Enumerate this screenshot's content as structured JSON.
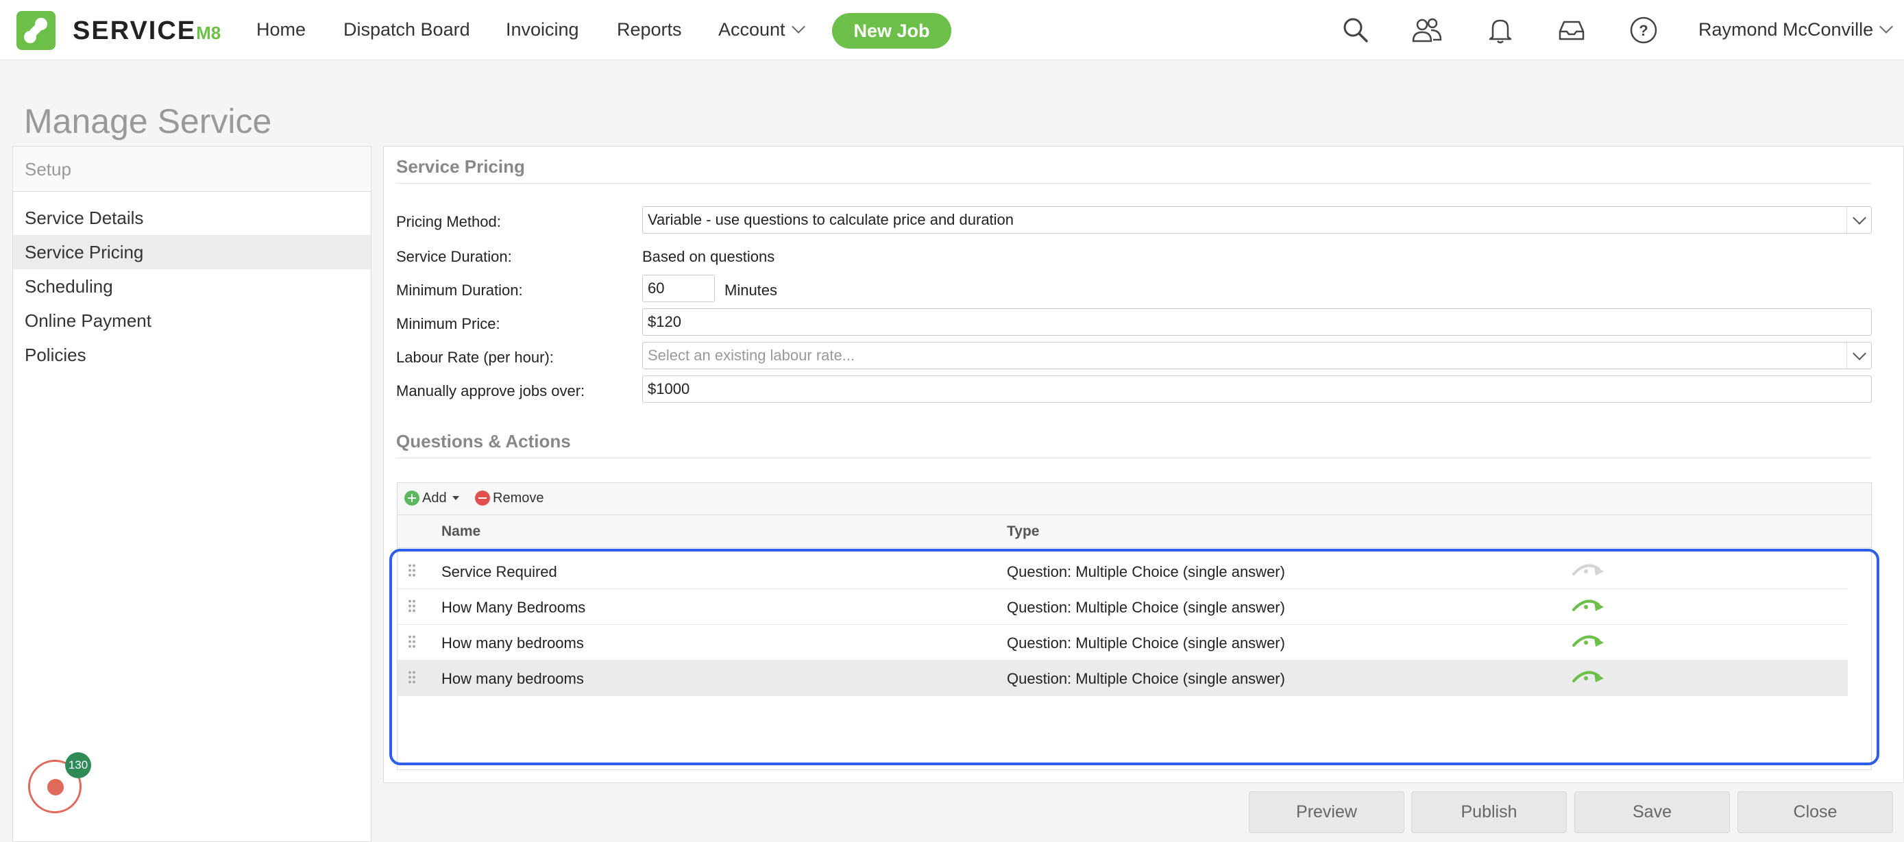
{
  "app": {
    "logo_text": "SERVICE",
    "logo_suffix": "M8"
  },
  "nav": {
    "items": [
      "Home",
      "Dispatch Board",
      "Invoicing",
      "Reports",
      "Account"
    ],
    "new_job": "New Job",
    "user_name": "Raymond McConville"
  },
  "page": {
    "title": "Manage Service"
  },
  "sidebar": {
    "heading": "Setup",
    "items": [
      "Service Details",
      "Service Pricing",
      "Scheduling",
      "Online Payment",
      "Policies"
    ],
    "active": "Service Pricing",
    "recorder_badge": "130"
  },
  "pricing": {
    "section_title": "Service Pricing",
    "method_label": "Pricing Method:",
    "method_value": "Variable - use questions to calculate price and duration",
    "duration_label": "Service Duration:",
    "duration_value": "Based on questions",
    "min_duration_label": "Minimum Duration:",
    "min_duration_value": "60",
    "min_duration_unit": "Minutes",
    "min_price_label": "Minimum Price:",
    "min_price_value": "$120",
    "labour_label": "Labour Rate (per hour):",
    "labour_placeholder": "Select an existing labour rate...",
    "approve_label": "Manually approve jobs over:",
    "approve_value": "$1000"
  },
  "questions": {
    "section_title": "Questions & Actions",
    "add_label": "Add",
    "remove_label": "Remove",
    "col_name": "Name",
    "col_type": "Type",
    "rows": [
      {
        "name": "Service Required",
        "type": "Question: Multiple Choice (single answer)",
        "icon": "redirect-icon-inactive"
      },
      {
        "name": "How Many Bedrooms",
        "type": "Question: Multiple Choice (single answer)",
        "icon": "redirect-icon-active"
      },
      {
        "name": "How many bedrooms",
        "type": "Question: Multiple Choice (single answer)",
        "icon": "redirect-icon-active"
      },
      {
        "name": "How many bedrooms",
        "type": "Question: Multiple Choice (single answer)",
        "icon": "redirect-icon-active"
      }
    ]
  },
  "footer": {
    "preview": "Preview",
    "publish": "Publish",
    "save": "Save",
    "close": "Close"
  },
  "colors": {
    "brand_green": "#6cc04a",
    "highlight_blue": "#2e5fe8",
    "record_red": "#e06a5a"
  }
}
